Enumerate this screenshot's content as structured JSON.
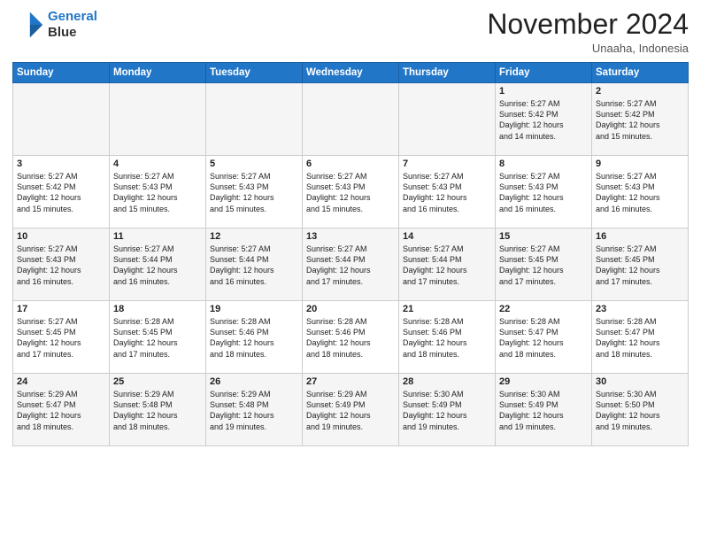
{
  "logo": {
    "line1": "General",
    "line2": "Blue"
  },
  "title": "November 2024",
  "location": "Unaaha, Indonesia",
  "days_of_week": [
    "Sunday",
    "Monday",
    "Tuesday",
    "Wednesday",
    "Thursday",
    "Friday",
    "Saturday"
  ],
  "weeks": [
    [
      {
        "day": "",
        "info": ""
      },
      {
        "day": "",
        "info": ""
      },
      {
        "day": "",
        "info": ""
      },
      {
        "day": "",
        "info": ""
      },
      {
        "day": "",
        "info": ""
      },
      {
        "day": "1",
        "info": "Sunrise: 5:27 AM\nSunset: 5:42 PM\nDaylight: 12 hours\nand 14 minutes."
      },
      {
        "day": "2",
        "info": "Sunrise: 5:27 AM\nSunset: 5:42 PM\nDaylight: 12 hours\nand 15 minutes."
      }
    ],
    [
      {
        "day": "3",
        "info": "Sunrise: 5:27 AM\nSunset: 5:42 PM\nDaylight: 12 hours\nand 15 minutes."
      },
      {
        "day": "4",
        "info": "Sunrise: 5:27 AM\nSunset: 5:43 PM\nDaylight: 12 hours\nand 15 minutes."
      },
      {
        "day": "5",
        "info": "Sunrise: 5:27 AM\nSunset: 5:43 PM\nDaylight: 12 hours\nand 15 minutes."
      },
      {
        "day": "6",
        "info": "Sunrise: 5:27 AM\nSunset: 5:43 PM\nDaylight: 12 hours\nand 15 minutes."
      },
      {
        "day": "7",
        "info": "Sunrise: 5:27 AM\nSunset: 5:43 PM\nDaylight: 12 hours\nand 16 minutes."
      },
      {
        "day": "8",
        "info": "Sunrise: 5:27 AM\nSunset: 5:43 PM\nDaylight: 12 hours\nand 16 minutes."
      },
      {
        "day": "9",
        "info": "Sunrise: 5:27 AM\nSunset: 5:43 PM\nDaylight: 12 hours\nand 16 minutes."
      }
    ],
    [
      {
        "day": "10",
        "info": "Sunrise: 5:27 AM\nSunset: 5:43 PM\nDaylight: 12 hours\nand 16 minutes."
      },
      {
        "day": "11",
        "info": "Sunrise: 5:27 AM\nSunset: 5:44 PM\nDaylight: 12 hours\nand 16 minutes."
      },
      {
        "day": "12",
        "info": "Sunrise: 5:27 AM\nSunset: 5:44 PM\nDaylight: 12 hours\nand 16 minutes."
      },
      {
        "day": "13",
        "info": "Sunrise: 5:27 AM\nSunset: 5:44 PM\nDaylight: 12 hours\nand 17 minutes."
      },
      {
        "day": "14",
        "info": "Sunrise: 5:27 AM\nSunset: 5:44 PM\nDaylight: 12 hours\nand 17 minutes."
      },
      {
        "day": "15",
        "info": "Sunrise: 5:27 AM\nSunset: 5:45 PM\nDaylight: 12 hours\nand 17 minutes."
      },
      {
        "day": "16",
        "info": "Sunrise: 5:27 AM\nSunset: 5:45 PM\nDaylight: 12 hours\nand 17 minutes."
      }
    ],
    [
      {
        "day": "17",
        "info": "Sunrise: 5:27 AM\nSunset: 5:45 PM\nDaylight: 12 hours\nand 17 minutes."
      },
      {
        "day": "18",
        "info": "Sunrise: 5:28 AM\nSunset: 5:45 PM\nDaylight: 12 hours\nand 17 minutes."
      },
      {
        "day": "19",
        "info": "Sunrise: 5:28 AM\nSunset: 5:46 PM\nDaylight: 12 hours\nand 18 minutes."
      },
      {
        "day": "20",
        "info": "Sunrise: 5:28 AM\nSunset: 5:46 PM\nDaylight: 12 hours\nand 18 minutes."
      },
      {
        "day": "21",
        "info": "Sunrise: 5:28 AM\nSunset: 5:46 PM\nDaylight: 12 hours\nand 18 minutes."
      },
      {
        "day": "22",
        "info": "Sunrise: 5:28 AM\nSunset: 5:47 PM\nDaylight: 12 hours\nand 18 minutes."
      },
      {
        "day": "23",
        "info": "Sunrise: 5:28 AM\nSunset: 5:47 PM\nDaylight: 12 hours\nand 18 minutes."
      }
    ],
    [
      {
        "day": "24",
        "info": "Sunrise: 5:29 AM\nSunset: 5:47 PM\nDaylight: 12 hours\nand 18 minutes."
      },
      {
        "day": "25",
        "info": "Sunrise: 5:29 AM\nSunset: 5:48 PM\nDaylight: 12 hours\nand 18 minutes."
      },
      {
        "day": "26",
        "info": "Sunrise: 5:29 AM\nSunset: 5:48 PM\nDaylight: 12 hours\nand 19 minutes."
      },
      {
        "day": "27",
        "info": "Sunrise: 5:29 AM\nSunset: 5:49 PM\nDaylight: 12 hours\nand 19 minutes."
      },
      {
        "day": "28",
        "info": "Sunrise: 5:30 AM\nSunset: 5:49 PM\nDaylight: 12 hours\nand 19 minutes."
      },
      {
        "day": "29",
        "info": "Sunrise: 5:30 AM\nSunset: 5:49 PM\nDaylight: 12 hours\nand 19 minutes."
      },
      {
        "day": "30",
        "info": "Sunrise: 5:30 AM\nSunset: 5:50 PM\nDaylight: 12 hours\nand 19 minutes."
      }
    ]
  ]
}
